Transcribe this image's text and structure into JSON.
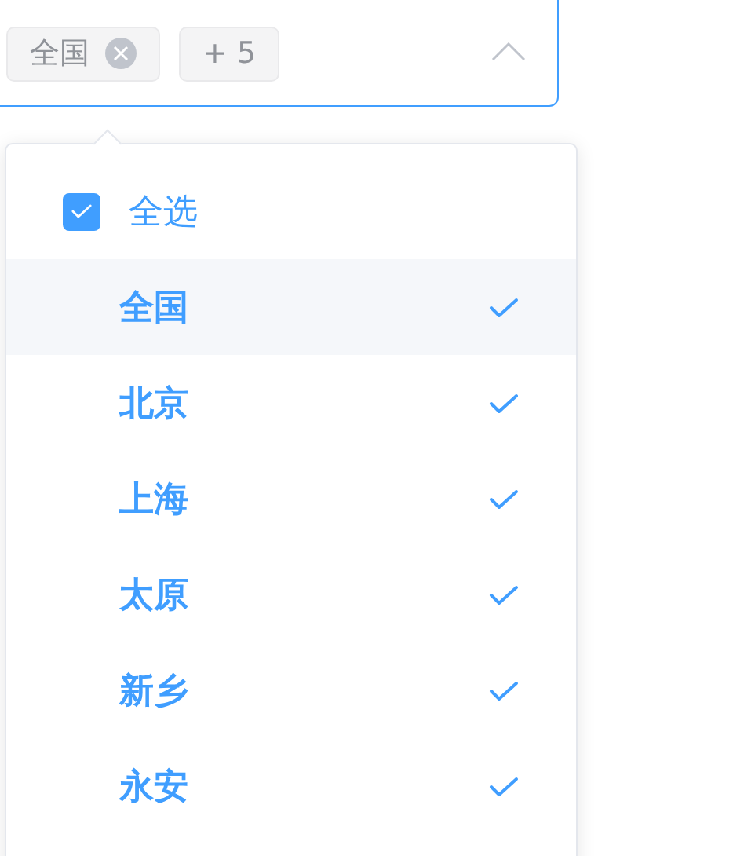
{
  "select": {
    "tags": [
      {
        "label": "全国",
        "closable": true
      },
      {
        "label": "+ 5",
        "closable": false
      }
    ],
    "expanded": true
  },
  "dropdown": {
    "select_all": {
      "label": "全选",
      "checked": true
    },
    "options": [
      {
        "label": "全国",
        "selected": true,
        "hovered": true
      },
      {
        "label": "北京",
        "selected": true,
        "hovered": false
      },
      {
        "label": "上海",
        "selected": true,
        "hovered": false
      },
      {
        "label": "太原",
        "selected": true,
        "hovered": false
      },
      {
        "label": "新乡",
        "selected": true,
        "hovered": false
      },
      {
        "label": "永安",
        "selected": true,
        "hovered": false
      }
    ]
  }
}
